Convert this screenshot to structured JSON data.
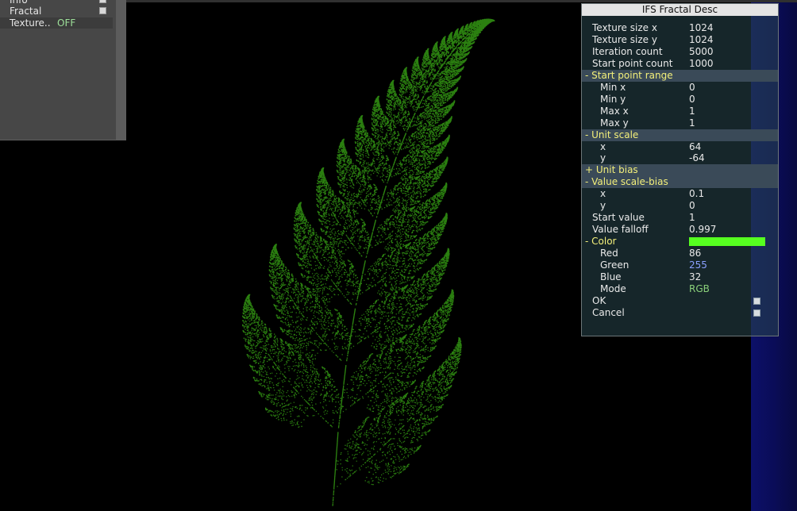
{
  "left_panel": {
    "items": [
      {
        "label": "Info",
        "value": "",
        "checkbox": true
      },
      {
        "label": "Fractal",
        "value": "",
        "checkbox": true
      },
      {
        "label": "Texture..",
        "value": "OFF",
        "checkbox": false
      }
    ]
  },
  "dialog": {
    "title": "IFS Fractal Desc",
    "rows": [
      {
        "key": "Texture size x",
        "value": "1024",
        "type": "field"
      },
      {
        "key": "Texture size y",
        "value": "1024",
        "type": "field"
      },
      {
        "key": "Iteration count",
        "value": "5000",
        "type": "field"
      },
      {
        "key": "Start point count",
        "value": "1000",
        "type": "field"
      },
      {
        "key": "- Start point range",
        "value": "",
        "type": "group"
      },
      {
        "key": "Min x",
        "value": "0",
        "type": "sub"
      },
      {
        "key": "Min y",
        "value": "0",
        "type": "sub"
      },
      {
        "key": "Max x",
        "value": "1",
        "type": "sub"
      },
      {
        "key": "Max y",
        "value": "1",
        "type": "sub"
      },
      {
        "key": "- Unit scale",
        "value": "",
        "type": "group"
      },
      {
        "key": "x",
        "value": "64",
        "type": "sub"
      },
      {
        "key": "y",
        "value": "-64",
        "type": "sub"
      },
      {
        "key": "+ Unit bias",
        "value": "",
        "type": "group"
      },
      {
        "key": "- Value scale-bias",
        "value": "",
        "type": "group"
      },
      {
        "key": "x",
        "value": "0.1",
        "type": "sub"
      },
      {
        "key": "y",
        "value": "0",
        "type": "sub"
      },
      {
        "key": "Start value",
        "value": "1",
        "type": "field"
      },
      {
        "key": "Value falloff",
        "value": "0.997",
        "type": "field"
      },
      {
        "key": "- Color",
        "value": "",
        "type": "color"
      },
      {
        "key": "Red",
        "value": "86",
        "type": "sub"
      },
      {
        "key": "Green",
        "value": "255",
        "type": "sub",
        "style": "blue"
      },
      {
        "key": "Blue",
        "value": "32",
        "type": "sub"
      },
      {
        "key": "Mode",
        "value": "RGB",
        "type": "sub",
        "style": "green"
      },
      {
        "key": "OK",
        "value": "",
        "type": "button"
      },
      {
        "key": "Cancel",
        "value": "",
        "type": "button"
      }
    ]
  },
  "colors": {
    "fern_color": "#56ff20",
    "background": "#000000",
    "group_text": "#f3ef7a"
  },
  "icons": [
    "checkbox-icon",
    "fern-fractal-image"
  ]
}
